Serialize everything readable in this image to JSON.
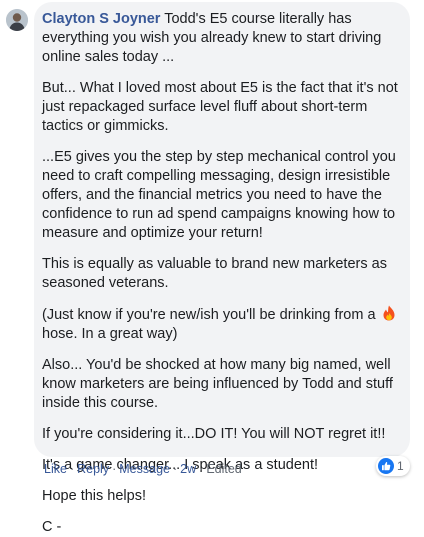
{
  "comment": {
    "author": "Clayton S Joyner",
    "paragraphs": [
      "Todd's E5 course literally has everything you wish you already knew to start driving online sales today ...",
      "But... What I loved most about E5 is the fact that it's not just repackaged surface level fluff about short-term tactics or gimmicks.",
      "...E5 gives you the step by step mechanical control you need to craft compelling messaging, design irresistible offers, and the financial metrics you need to have the confidence to run ad spend campaigns knowing how to measure and optimize your return!",
      "This is equally as valuable to brand new marketers as seasoned veterans.",
      "(Just know if you're new/ish you'll be drinking from a",
      "hose. In a great way)",
      "Also... You'd be shocked at how many big named, well know marketers are being influenced by Todd and stuff inside this course.",
      "If you're considering it...DO IT! You will NOT regret it!!",
      "It's a game changer... I speak as a student!",
      "Hope this helps!",
      "C -"
    ],
    "fire_emoji": "fire-emoji"
  },
  "actions": {
    "like": "Like",
    "reply": "Reply",
    "message": "Message",
    "time": "2w",
    "edited": "Edited",
    "separator": "·"
  },
  "reactions": {
    "icon": "thumbs-up-icon",
    "count": "1"
  },
  "colors": {
    "bubble": "#f2f3f5",
    "author": "#385898",
    "meta": "#606770",
    "like_blue": "#1877f2"
  }
}
